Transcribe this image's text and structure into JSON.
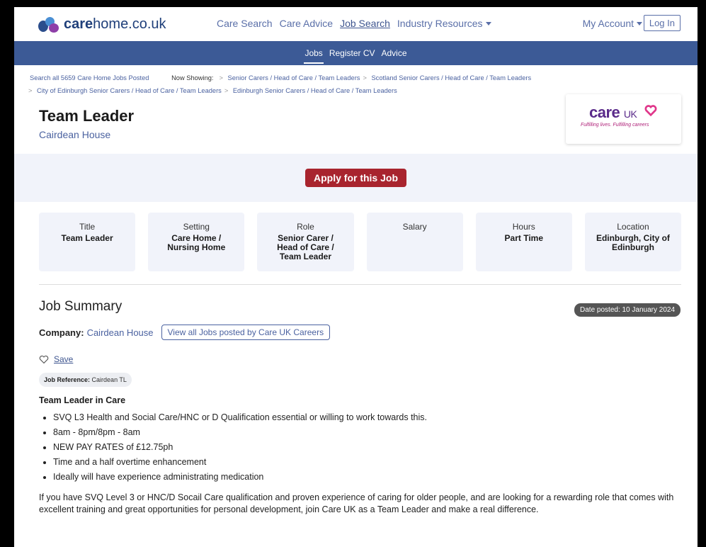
{
  "site": {
    "logo_prefix": "care",
    "logo_suffix": "home.co.uk"
  },
  "nav": {
    "items": [
      "Care Search",
      "Care Advice",
      "Job Search",
      "Industry Resources"
    ],
    "my_account": "My Account",
    "login": "Log In"
  },
  "subnav": {
    "items": [
      "Jobs",
      "Register CV",
      "Advice"
    ]
  },
  "breadcrumb": {
    "search_all": "Search all 5659 Care Home Jobs Posted",
    "now_showing": "Now Showing:",
    "crumb_1": "Senior Carers / Head of Care / Team Leaders",
    "crumb_2": "Scotland Senior Carers / Head of Care / Team Leaders",
    "crumb_3": "City of Edinburgh Senior Carers / Head of Care / Team Leaders",
    "crumb_4": "Edinburgh Senior Carers / Head of Care / Team Leaders",
    "sep": ">"
  },
  "job": {
    "title": "Team Leader",
    "company": "Cairdean House",
    "apply_label": "Apply for this Job"
  },
  "brand": {
    "name": "care",
    "name_suffix": "UK",
    "tagline": "Fulfilling lives. Fulfilling careers"
  },
  "details": [
    {
      "label": "Title",
      "value": "Team Leader"
    },
    {
      "label": "Setting",
      "value": "Care Home / Nursing Home"
    },
    {
      "label": "Role",
      "value": "Senior Carer / Head of Care / Team Leader"
    },
    {
      "label": "Salary",
      "value": ""
    },
    {
      "label": "Hours",
      "value": "Part Time"
    },
    {
      "label": "Location",
      "value": "Edinburgh, City of Edinburgh"
    }
  ],
  "summary": {
    "heading": "Job Summary",
    "date_posted": "Date posted: 10 January 2024",
    "company_label": "Company:",
    "company_value": "Cairdean House",
    "view_all": "View all Jobs posted by Care UK Careers",
    "save_label": "Save",
    "ref_label": "Job Reference:",
    "ref_value": "Cairdean TL",
    "body_heading": "Team Leader in Care",
    "bullets": [
      "SVQ L3 Health and Social Care/HNC or D Qualification essential or willing to work towards this.",
      "8am - 8pm/8pm - 8am",
      "NEW PAY RATES of £12.75ph",
      "Time and a half overtime enhancement",
      "Ideally will have experience administrating medication"
    ],
    "paragraph": "If you have SVQ Level 3 or HNC/D Socail Care qualification and proven experience of caring for older people, and are looking for a rewarding role that comes with excellent training and great opportunities for personal development, join Care UK as a Team Leader and make a real difference."
  },
  "colors": {
    "brand_blue": "#3c5a96",
    "link_blue": "#4b62a0",
    "apply_red": "#a8242e",
    "panel_bg": "#f1f3fa"
  }
}
